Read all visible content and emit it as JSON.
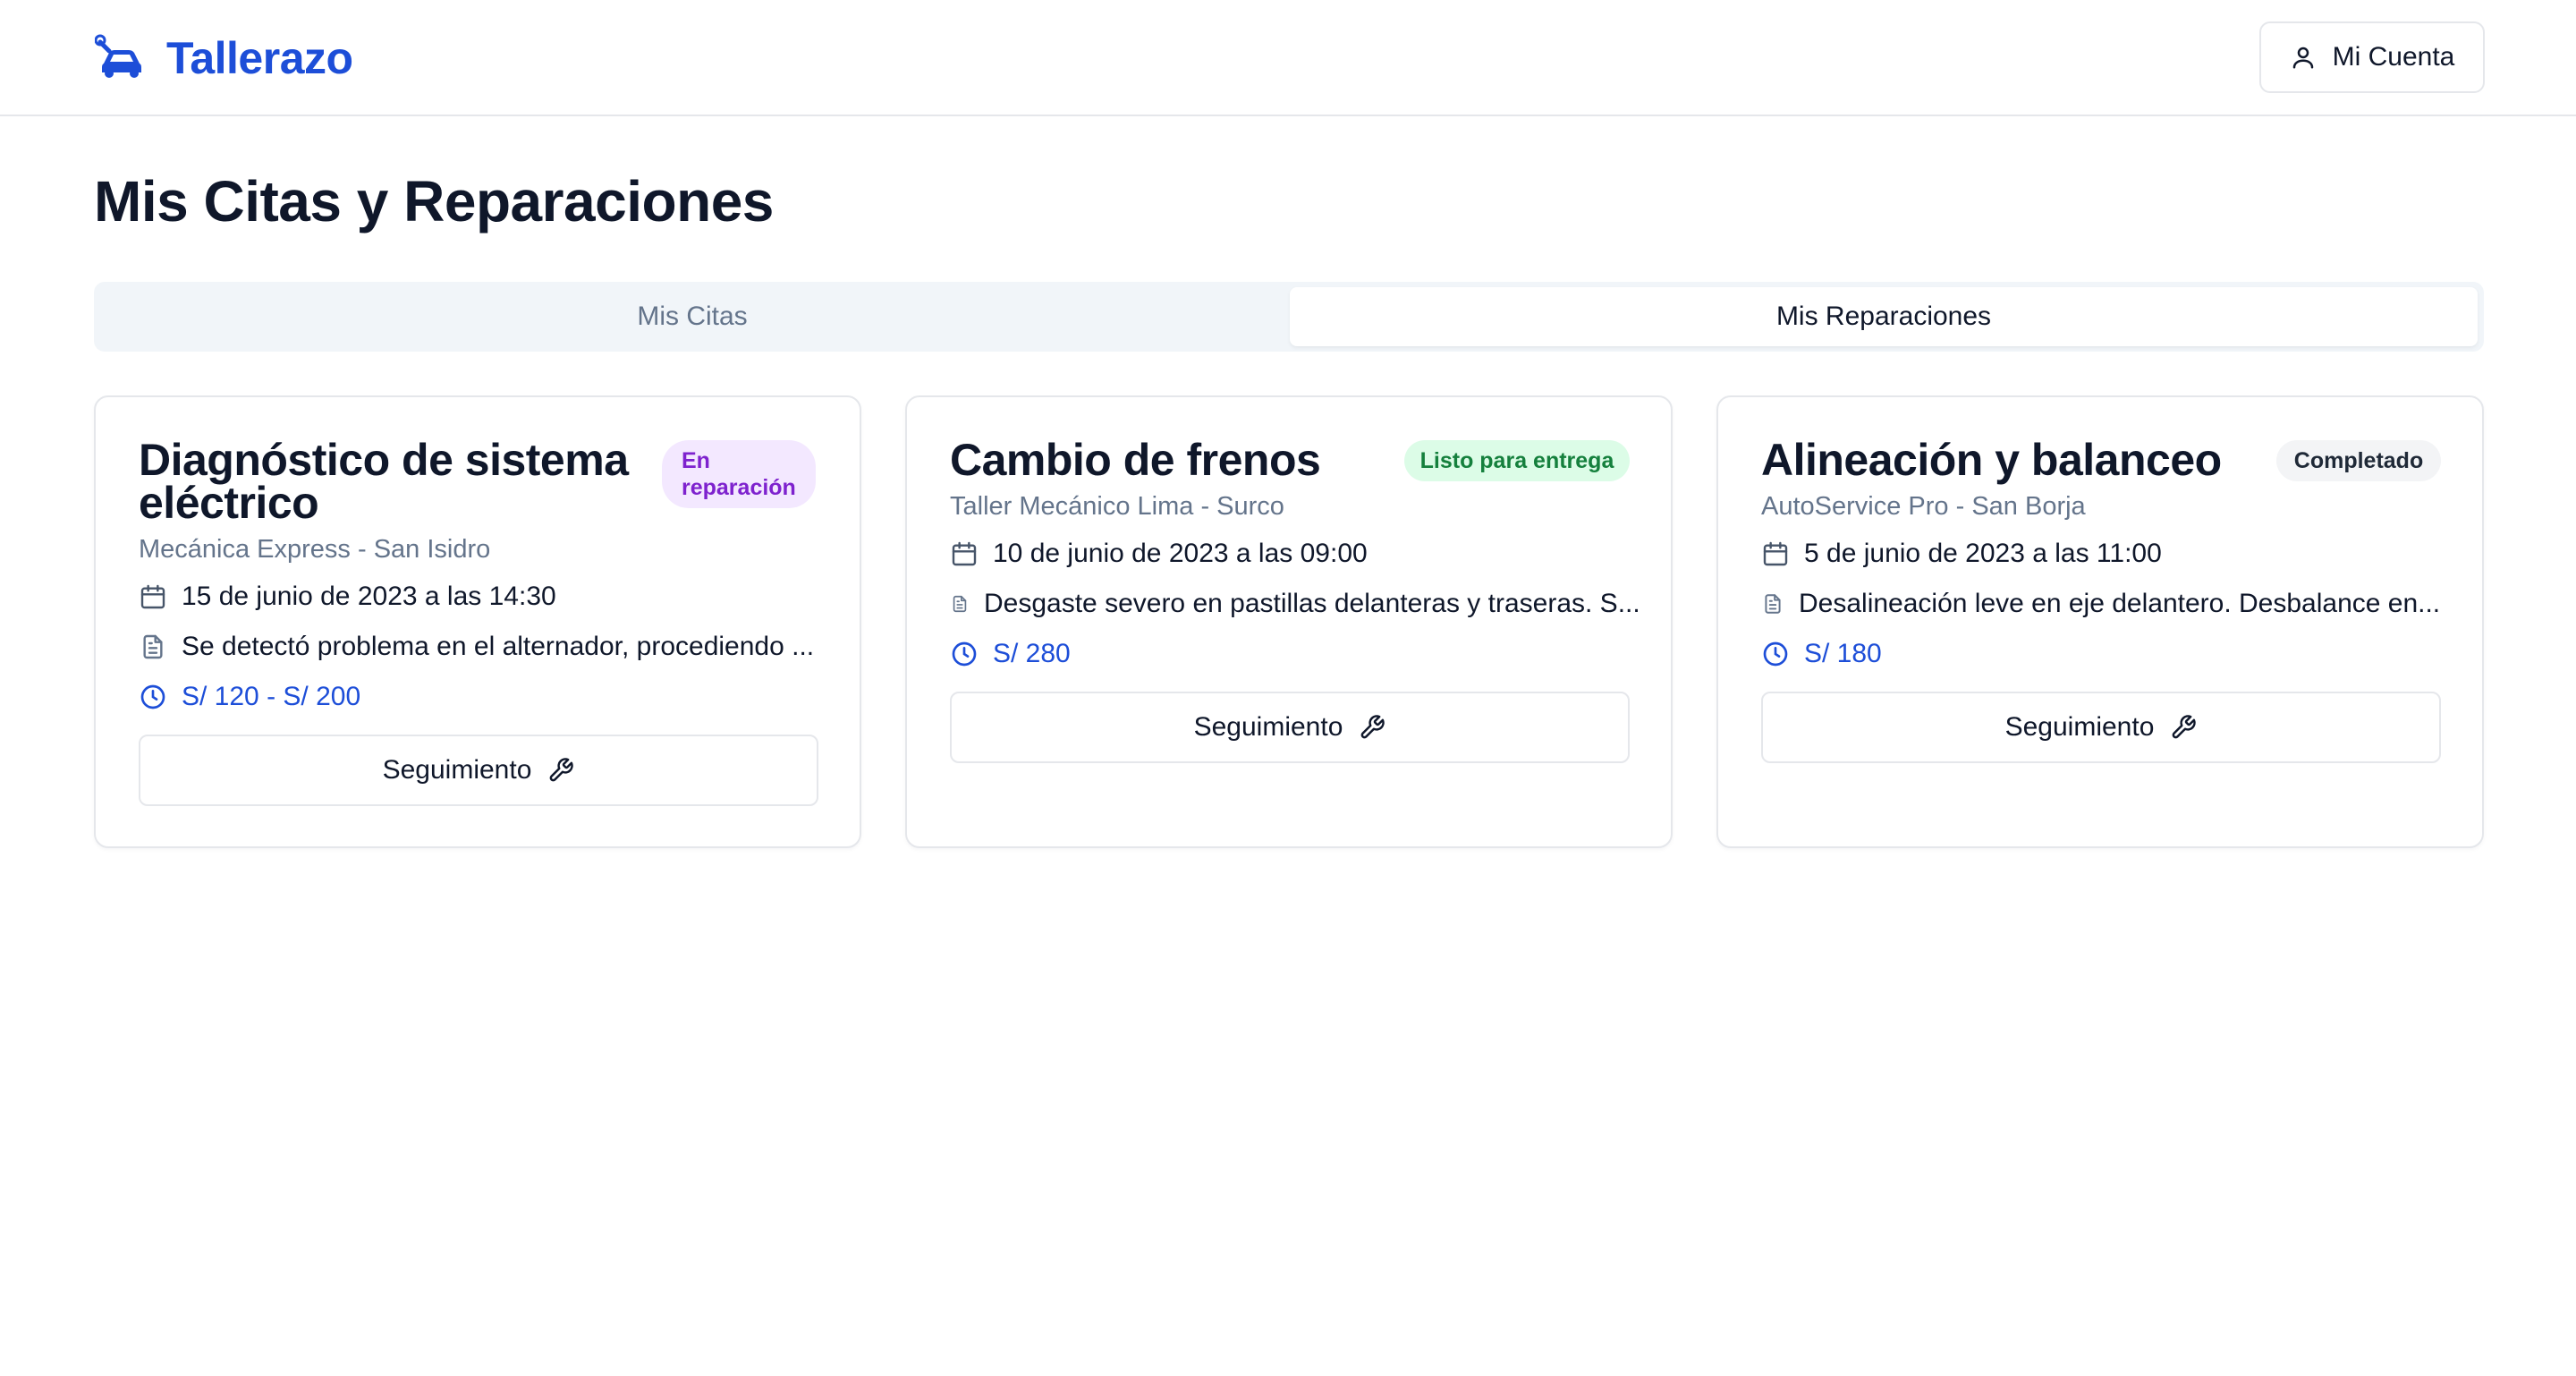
{
  "header": {
    "brand": "Tallerazo",
    "brand_icon": "car-wrench-icon",
    "account_label": "Mi Cuenta",
    "account_icon": "user-icon"
  },
  "page": {
    "title": "Mis Citas y Reparaciones"
  },
  "tabs": [
    {
      "label": "Mis Citas",
      "active": false
    },
    {
      "label": "Mis Reparaciones",
      "active": true
    }
  ],
  "cards": [
    {
      "title_line1": "Diagnóstico de sistema",
      "title_line2": "eléctrico",
      "badge_line1": "En",
      "badge_line2": "reparación",
      "badge_color": "#7e22ce",
      "badge_bg": "#f3e8ff",
      "shop": "Mecánica Express - San Isidro",
      "date": "15 de junio de 2023 a las 14:30",
      "note": "Se detectó problema en el alternador, procediendo ...",
      "price": "S/ 120 - S/ 200",
      "button": "Seguimiento"
    },
    {
      "title_line1": "Cambio de frenos",
      "badge": "Listo para entrega",
      "badge_color": "#15803d",
      "badge_bg": "#dcfce7",
      "shop": "Taller Mecánico Lima - Surco",
      "date": "10 de junio de 2023 a las 09:00",
      "note": "Desgaste severo en pastillas delanteras y traseras. S...",
      "price": "S/ 280",
      "button": "Seguimiento"
    },
    {
      "title_line1": "Alineación y balanceo",
      "badge": "Completado",
      "badge_color": "#1f2937",
      "badge_bg": "#f3f4f6",
      "shop": "AutoService Pro - San Borja",
      "date": "5 de junio de 2023 a las 11:00",
      "note": "Desalineación leve en eje delantero. Desbalance en...",
      "price": "S/ 180",
      "button": "Seguimiento"
    }
  ],
  "colors": {
    "brand": "#1d4ed8",
    "muted": "#64748b",
    "border": "#e5e7eb"
  }
}
